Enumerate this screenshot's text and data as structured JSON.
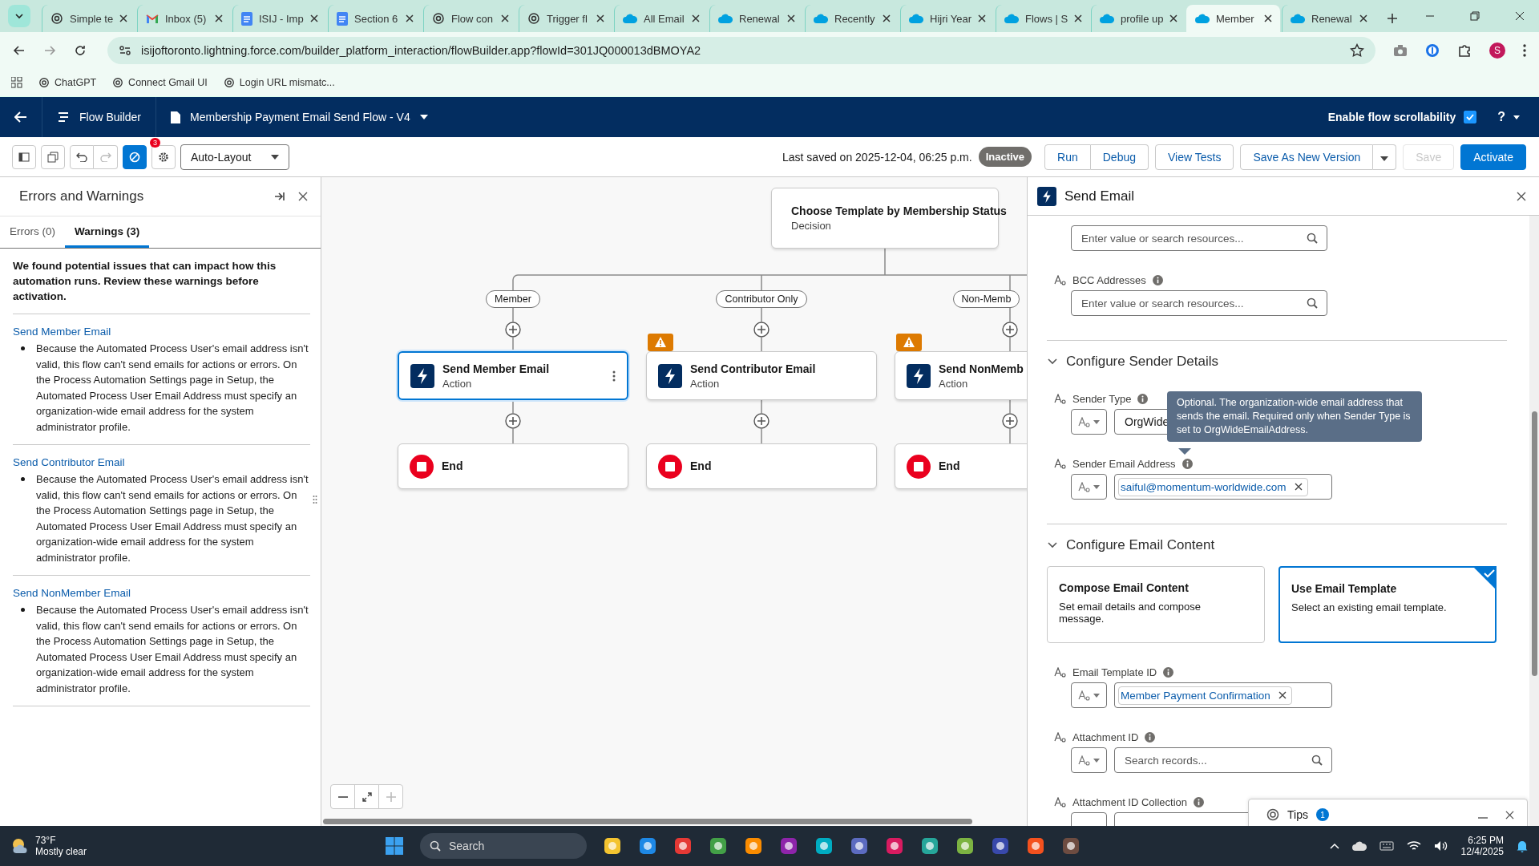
{
  "browser": {
    "tabs": [
      {
        "title": "Simple te",
        "kind": "chatgpt",
        "selected": false
      },
      {
        "title": "Inbox (5)",
        "kind": "gmail",
        "selected": false
      },
      {
        "title": "ISIJ - Imp",
        "kind": "docs",
        "selected": false
      },
      {
        "title": "Section 6",
        "kind": "docs",
        "selected": false
      },
      {
        "title": "Flow con",
        "kind": "chatgpt",
        "selected": false
      },
      {
        "title": "Trigger fl",
        "kind": "chatgpt",
        "selected": false
      },
      {
        "title": "All Email",
        "kind": "salesforce",
        "selected": false
      },
      {
        "title": "Renewal",
        "kind": "salesforce",
        "selected": false
      },
      {
        "title": "Recently",
        "kind": "salesforce",
        "selected": false
      },
      {
        "title": "Hijri Year",
        "kind": "salesforce",
        "selected": false
      },
      {
        "title": "Flows | S",
        "kind": "salesforce",
        "selected": false
      },
      {
        "title": "profile up",
        "kind": "salesforce",
        "selected": false
      },
      {
        "title": "Member",
        "kind": "salesforce",
        "selected": true
      },
      {
        "title": "Renewal",
        "kind": "salesforce",
        "selected": false
      }
    ],
    "url": "isijoftoronto.lightning.force.com/builder_platform_interaction/flowBuilder.app?flowId=301JQ000013dBMOYA2",
    "profile_initial": "S",
    "bookmarks": [
      {
        "label": "ChatGPT"
      },
      {
        "label": "Connect Gmail UI"
      },
      {
        "label": "Login URL mismatc..."
      }
    ]
  },
  "app_header": {
    "app_name": "Flow Builder",
    "flow_title": "Membership Payment Email Send Flow - V4",
    "scroll_toggle": {
      "label": "Enable flow scrollability",
      "checked": true
    },
    "help": "?"
  },
  "toolbar": {
    "error_badge": "3",
    "layout": "Auto-Layout",
    "last_saved": "Last saved on 2025-12-04, 06:25 p.m.",
    "status": "Inactive",
    "buttons": [
      {
        "label": "Run",
        "kind": "group-start"
      },
      {
        "label": "Debug",
        "kind": "group-end"
      },
      {
        "label": "View Tests",
        "kind": "neutral"
      },
      {
        "label": "Save As New Version",
        "kind": "split"
      },
      {
        "label": "Save",
        "kind": "disabled"
      },
      {
        "label": "Activate",
        "kind": "brand"
      }
    ]
  },
  "errors_panel": {
    "title": "Errors and Warnings",
    "tabs": [
      {
        "label": "Errors (0)",
        "selected": false
      },
      {
        "label": "Warnings (3)",
        "selected": true
      }
    ],
    "intro": "We found potential issues that can impact how this automation runs. Review these warnings before activation.",
    "warnings": [
      {
        "element": "Send Member Email",
        "message": "Because the Automated Process User's email address isn't valid, this flow can't send emails for actions or errors. On the Process Automation Settings page in Setup, the Automated Process User Email Address must specify an organization-wide email address for the system administrator profile."
      },
      {
        "element": "Send Contributor Email",
        "message": "Because the Automated Process User's email address isn't valid, this flow can't send emails for actions or errors. On the Process Automation Settings page in Setup, the Automated Process User Email Address must specify an organization-wide email address for the system administrator profile."
      },
      {
        "element": "Send NonMember Email",
        "message": "Because the Automated Process User's email address isn't valid, this flow can't send emails for actions or errors. On the Process Automation Settings page in Setup, the Automated Process User Email Address must specify an organization-wide email address for the system administrator profile."
      }
    ]
  },
  "canvas": {
    "decision": {
      "title": "Choose Template by Membership Status",
      "type": "Decision"
    },
    "branches": [
      {
        "label": "Member",
        "warning": false,
        "action": {
          "title": "Send Member Email",
          "type": "Action",
          "selected": true
        },
        "end": "End"
      },
      {
        "label": "Contributor Only",
        "warning": true,
        "action": {
          "title": "Send Contributor Email",
          "type": "Action",
          "selected": false
        },
        "end": "End"
      },
      {
        "label": "Non-Memb",
        "warning": true,
        "action": {
          "title": "Send NonMemb",
          "type": "Action",
          "selected": false
        },
        "end": "End"
      }
    ]
  },
  "property_panel": {
    "title": "Send Email",
    "items": [
      {
        "kind": "lookup",
        "placeholder": "Enter value or search resources..."
      },
      {
        "kind": "lookup",
        "label": "BCC Addresses",
        "placeholder": "Enter value or search resources..."
      },
      {
        "kind": "section",
        "title": "Configure Sender Details",
        "expanded": true
      },
      {
        "kind": "typed",
        "label": "Sender Type",
        "value": "OrgWide"
      },
      {
        "kind": "typed",
        "label": "Sender Email Address",
        "pill": "saiful@momentum-worldwide.com"
      },
      {
        "kind": "section",
        "title": "Configure Email Content",
        "expanded": true
      },
      {
        "kind": "choice",
        "options": [
          {
            "title": "Compose Email Content",
            "description": "Set email details and compose message.",
            "selected": false
          },
          {
            "title": "Use Email Template",
            "description": "Select an existing email template.",
            "selected": true
          }
        ]
      },
      {
        "kind": "typed",
        "label": "Email Template ID",
        "pill": "Member Payment Confirmation"
      },
      {
        "kind": "typed",
        "label": "Attachment ID",
        "placeholder": "Search records..."
      },
      {
        "kind": "typed",
        "label": "Attachment ID Collection"
      }
    ],
    "tooltip": "Optional. The organization-wide email address that sends the email. Required only when Sender Type is set to OrgWideEmailAddress.",
    "tips": {
      "label": "Tips",
      "count": "1"
    }
  },
  "taskbar": {
    "temperature": "73°F",
    "weather": "Mostly clear",
    "search": "Search",
    "time": "6:25 PM",
    "date": "12/4/2025"
  }
}
